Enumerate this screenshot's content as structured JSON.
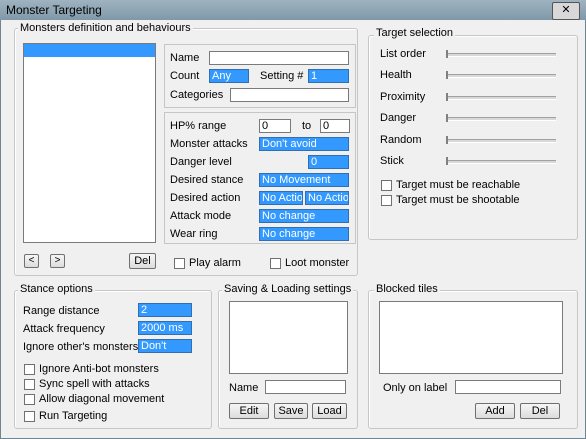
{
  "window": {
    "title": "Monster Targeting",
    "close_glyph": "✕"
  },
  "monsters": {
    "title": "Monsters definition and behaviours",
    "prev_glyph": "<",
    "next_glyph": ">",
    "del": "Del",
    "name_label": "Name",
    "name_value": "",
    "count_label": "Count",
    "count_value": "Any",
    "setting_label": "Setting #",
    "setting_value": "1",
    "categories_label": "Categories",
    "categories_value": "",
    "hp_range_label": "HP% range",
    "hp_from": "0",
    "hp_to_label": "to",
    "hp_to": "0",
    "monster_attacks_label": "Monster attacks",
    "monster_attacks_value": "Don't avoid",
    "danger_level_label": "Danger level",
    "danger_level_value": "0",
    "desired_stance_label": "Desired stance",
    "desired_stance_value": "No Movement",
    "desired_action_label": "Desired action",
    "desired_action_value1": "No Action",
    "desired_action_value2": "No Action",
    "attack_mode_label": "Attack mode",
    "attack_mode_value": "No change",
    "wear_ring_label": "Wear ring",
    "wear_ring_value": "No change",
    "play_alarm": "Play alarm",
    "loot_monster": "Loot monster"
  },
  "target_selection": {
    "title": "Target selection",
    "sliders": [
      {
        "label": "List order",
        "level": 0
      },
      {
        "label": "Health",
        "level": 0
      },
      {
        "label": "Proximity",
        "level": 0
      },
      {
        "label": "Danger",
        "level": 0
      },
      {
        "label": "Random",
        "level": 0
      },
      {
        "label": "Stick",
        "level": 0
      }
    ],
    "reachable": "Target must be reachable",
    "shootable": "Target must be shootable"
  },
  "stance": {
    "title": "Stance options",
    "range_label": "Range distance",
    "range_value": "2",
    "freq_label": "Attack frequency",
    "freq_value": "2000 ms",
    "ignore_label": "Ignore other's monsters",
    "ignore_value": "Don't",
    "ignore_antibot": "Ignore Anti-bot monsters",
    "sync_spell": "Sync spell with attacks",
    "allow_diag": "Allow diagonal movement",
    "run_targeting": "Run Targeting"
  },
  "saving": {
    "title": "Saving & Loading settings",
    "name_label": "Name",
    "name_value": "",
    "edit": "Edit",
    "save": "Save",
    "load": "Load"
  },
  "blocked": {
    "title": "Blocked tiles",
    "only_label": "Only on label",
    "only_value": "",
    "add": "Add",
    "del": "Del"
  }
}
